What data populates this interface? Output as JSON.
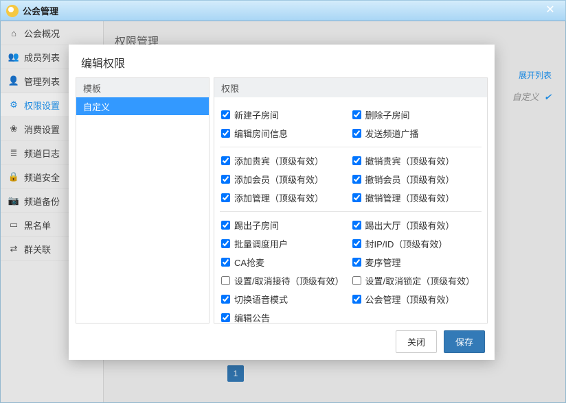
{
  "window": {
    "title": "公会管理"
  },
  "sidebar": {
    "items": [
      {
        "label": "公会概况",
        "icon": "home"
      },
      {
        "label": "成员列表",
        "icon": "users"
      },
      {
        "label": "管理列表",
        "icon": "user"
      },
      {
        "label": "权限设置",
        "icon": "gear",
        "active": true
      },
      {
        "label": "消费设置",
        "icon": "leaf"
      },
      {
        "label": "频道日志",
        "icon": "list"
      },
      {
        "label": "频道安全",
        "icon": "lock"
      },
      {
        "label": "频道备份",
        "icon": "camera"
      },
      {
        "label": "黑名单",
        "icon": "id"
      },
      {
        "label": "群关联",
        "icon": "shuffle"
      }
    ]
  },
  "main": {
    "title": "权限管理",
    "expand": "展开列表",
    "custom": "自定义",
    "page": "1"
  },
  "modal": {
    "title": "编辑权限",
    "template_header": "模板",
    "template_item": "自定义",
    "perm_header": "权限",
    "groups": [
      [
        {
          "label": "新建子房间",
          "checked": true
        },
        {
          "label": "删除子房间",
          "checked": true
        },
        {
          "label": "编辑房间信息",
          "checked": true
        },
        {
          "label": "发送频道广播",
          "checked": true
        }
      ],
      [
        {
          "label": "添加贵宾（顶级有效）",
          "checked": true
        },
        {
          "label": "撤销贵宾（顶级有效）",
          "checked": true
        },
        {
          "label": "添加会员（顶级有效）",
          "checked": true
        },
        {
          "label": "撤销会员（顶级有效）",
          "checked": true
        },
        {
          "label": "添加管理（顶级有效）",
          "checked": true
        },
        {
          "label": "撤销管理（顶级有效）",
          "checked": true
        }
      ],
      [
        {
          "label": "踢出子房间",
          "checked": true
        },
        {
          "label": "踢出大厅（顶级有效）",
          "checked": true
        },
        {
          "label": "批量调度用户",
          "checked": true
        },
        {
          "label": "封IP/ID（顶级有效）",
          "checked": true
        },
        {
          "label": "CA抢麦",
          "checked": true
        },
        {
          "label": "麦序管理",
          "checked": true
        },
        {
          "label": "设置/取消接待（顶级有效）",
          "checked": false
        },
        {
          "label": "设置/取消锁定（顶级有效）",
          "checked": false
        },
        {
          "label": "切换语音模式",
          "checked": true
        },
        {
          "label": "公会管理（顶级有效）",
          "checked": true
        },
        {
          "label": "编辑公告",
          "checked": true
        }
      ]
    ],
    "close": "关闭",
    "save": "保存"
  },
  "icons": {
    "home": "⌂",
    "users": "👥",
    "user": "👤",
    "gear": "⚙",
    "leaf": "❀",
    "list": "≣",
    "lock": "🔒",
    "camera": "📷",
    "id": "▭",
    "shuffle": "⇄"
  }
}
